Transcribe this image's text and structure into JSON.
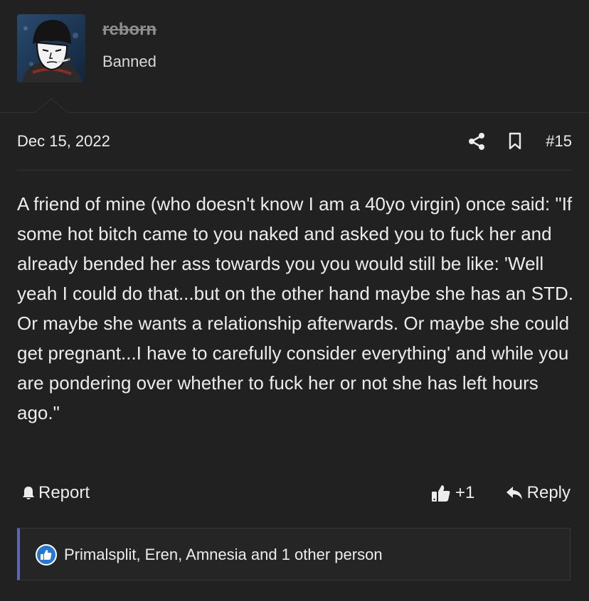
{
  "user": {
    "username": "reborn",
    "title": "Banned"
  },
  "post": {
    "date": "Dec 15, 2022",
    "number": "#15",
    "body": "A friend of mine (who doesn't know I am a 40yo virgin) once said: \"If some hot bitch came to you naked and asked you to fuck her and already bended her ass towards you you would still be like: 'Well yeah I could do that...but on the other hand maybe she has an STD. Or maybe she wants a relationship afterwards. Or maybe she could get pregnant...I have to carefully consider everything' and while you are pondering over whether to fuck her or not she has left hours ago.\""
  },
  "actions": {
    "report_label": "Report",
    "reaction_count": "+1",
    "reply_label": "Reply"
  },
  "reactions": {
    "text": "Primalsplit, Eren, Amnesia and 1 other person"
  },
  "icons": {
    "share": "share-icon",
    "bookmark": "bookmark-icon",
    "report": "bell-icon",
    "like": "thumbs-up-icon",
    "reply": "reply-icon",
    "reaction": "like-reaction-icon"
  },
  "colors": {
    "background": "#212121",
    "text": "#ececec",
    "muted": "#8e8e8e",
    "reaction_accent": "#5d68b3",
    "like_blue": "#2577d6"
  }
}
